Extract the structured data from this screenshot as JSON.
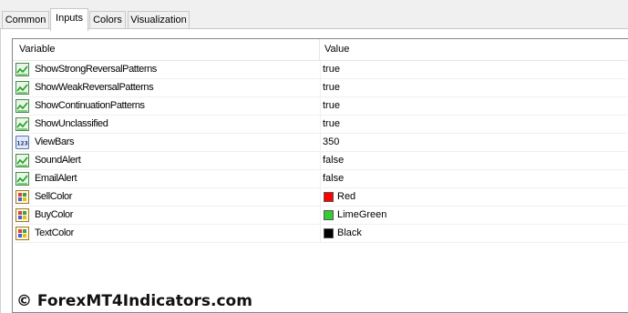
{
  "tabs": [
    {
      "label": "Common"
    },
    {
      "label": "Inputs"
    },
    {
      "label": "Colors"
    },
    {
      "label": "Visualization"
    }
  ],
  "active_tab": "Inputs",
  "table": {
    "headers": {
      "variable": "Variable",
      "value": "Value"
    },
    "rows": [
      {
        "name": "ShowStrongReversalPatterns",
        "value": "true",
        "icon": "bool-chart-icon"
      },
      {
        "name": "ShowWeakReversalPatterns",
        "value": "true",
        "icon": "bool-chart-icon"
      },
      {
        "name": "ShowContinuationPatterns",
        "value": "true",
        "icon": "bool-chart-icon"
      },
      {
        "name": "ShowUnclassified",
        "value": "true",
        "icon": "bool-chart-icon"
      },
      {
        "name": "ViewBars",
        "value": "350",
        "icon": "integer-123-icon"
      },
      {
        "name": "SoundAlert",
        "value": "false",
        "icon": "bool-chart-icon"
      },
      {
        "name": "EmailAlert",
        "value": "false",
        "icon": "bool-chart-icon"
      },
      {
        "name": "SellColor",
        "value": "Red",
        "icon": "color-palette-icon",
        "swatch": "#ff0000"
      },
      {
        "name": "BuyColor",
        "value": "LimeGreen",
        "icon": "color-palette-icon",
        "swatch": "#32cd32"
      },
      {
        "name": "TextColor",
        "value": "Black",
        "icon": "color-palette-icon",
        "swatch": "#000000"
      }
    ]
  },
  "watermark": "© ForexMT4Indicators.com",
  "colors": {
    "accent_green": "#1aa31a",
    "header_border": "#e5e5e5"
  }
}
